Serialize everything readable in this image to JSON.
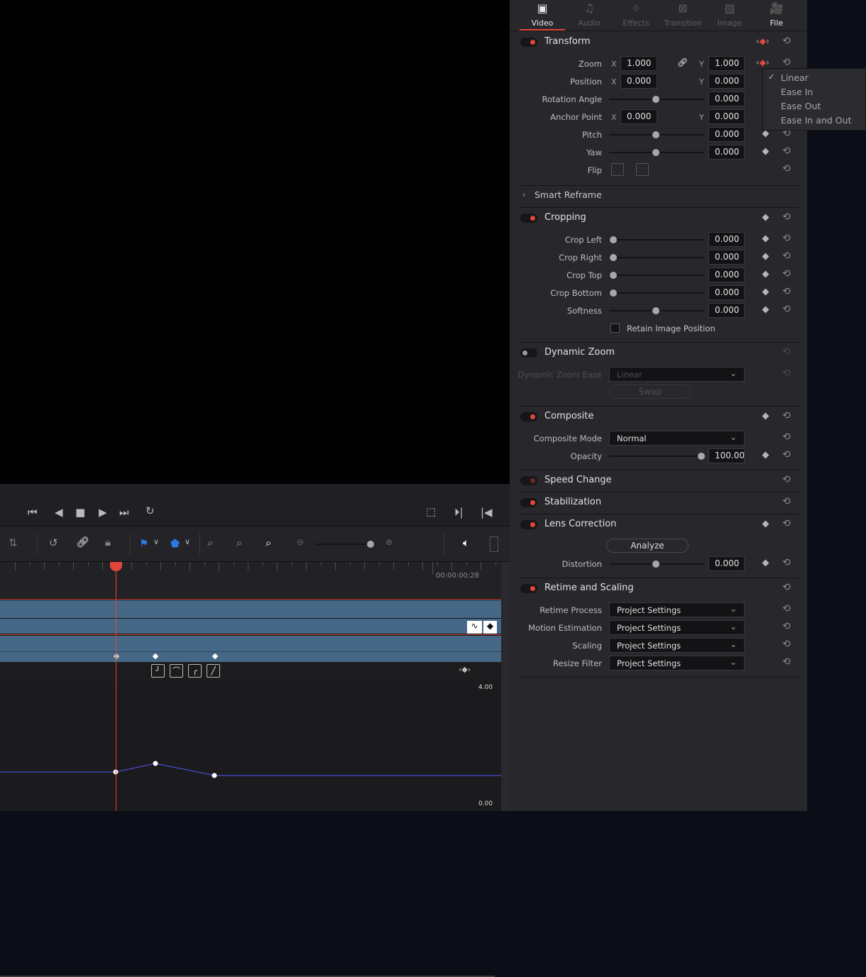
{
  "inspector": {
    "tabs": [
      {
        "label": "Video",
        "icon": "film-icon",
        "glyph": "▣",
        "active": true
      },
      {
        "label": "Audio",
        "icon": "music-note-icon",
        "glyph": "♫"
      },
      {
        "label": "Effects",
        "icon": "magic-wand-icon",
        "glyph": "✧"
      },
      {
        "label": "Transition",
        "icon": "transition-icon",
        "glyph": "⊠"
      },
      {
        "label": "Image",
        "icon": "image-icon",
        "glyph": "▨"
      },
      {
        "label": "File",
        "icon": "file-camera-icon",
        "glyph": "🎥",
        "active_text": true
      }
    ],
    "sections": [
      {
        "name": "transform",
        "title": "Transform",
        "toggle": "on",
        "keyframe": "nav",
        "rows": [
          {
            "label": "Zoom",
            "type": "xy",
            "x": "1.000",
            "y": "1.000",
            "link": true,
            "keyframe": "nav"
          },
          {
            "label": "Position",
            "type": "xy",
            "x": "0.000",
            "y": "0.000"
          },
          {
            "label": "Rotation Angle",
            "type": "slider",
            "value": "0.000",
            "level": 0.5
          },
          {
            "label": "Anchor Point",
            "type": "xy",
            "x": "0.000",
            "y": "0.000"
          },
          {
            "label": "Pitch",
            "type": "slider",
            "value": "0.000",
            "level": 0.5,
            "keyframe": "diamond"
          },
          {
            "label": "Yaw",
            "type": "slider",
            "value": "0.000",
            "level": 0.5,
            "keyframe": "diamond"
          },
          {
            "label": "Flip",
            "type": "flip"
          }
        ]
      },
      {
        "name": "smart-reframe",
        "title": "Smart Reframe",
        "collapsed": true,
        "rows": []
      },
      {
        "name": "cropping",
        "title": "Cropping",
        "toggle": "on",
        "keyframe": "diamond",
        "rows": [
          {
            "label": "Crop Left",
            "type": "slider",
            "value": "0.000",
            "level": 0,
            "keyframe": "diamond"
          },
          {
            "label": "Crop Right",
            "type": "slider",
            "value": "0.000",
            "level": 0,
            "keyframe": "diamond"
          },
          {
            "label": "Crop Top",
            "type": "slider",
            "value": "0.000",
            "level": 0,
            "keyframe": "diamond"
          },
          {
            "label": "Crop Bottom",
            "type": "slider",
            "value": "0.000",
            "level": 0,
            "keyframe": "diamond"
          },
          {
            "label": "Softness",
            "type": "slider",
            "value": "0.000",
            "level": 0.5,
            "keyframe": "diamond"
          },
          {
            "label": "Retain Image Position",
            "type": "checkbox",
            "checked": false
          }
        ]
      },
      {
        "name": "dynamic-zoom",
        "title": "Dynamic Zoom",
        "toggle": "off",
        "rows": [
          {
            "label": "Dynamic Zoom Ease",
            "type": "select",
            "value": "Linear",
            "disabled": true
          },
          {
            "label": "Swap",
            "type": "button",
            "disabled": true
          }
        ]
      },
      {
        "name": "composite",
        "title": "Composite",
        "toggle": "on",
        "keyframe": "diamond",
        "rows": [
          {
            "label": "Composite Mode",
            "type": "select",
            "value": "Normal"
          },
          {
            "label": "Opacity",
            "type": "slider",
            "value": "100.00",
            "level": 1,
            "keyframe": "diamond"
          }
        ]
      },
      {
        "name": "speed-change",
        "title": "Speed Change",
        "toggle": "dim",
        "rows": []
      },
      {
        "name": "stabilization",
        "title": "Stabilization",
        "toggle": "on",
        "rows": []
      },
      {
        "name": "lens-correction",
        "title": "Lens Correction",
        "toggle": "on",
        "keyframe": "diamond",
        "rows": [
          {
            "label": "Analyze",
            "type": "button"
          },
          {
            "label": "Distortion",
            "type": "slider",
            "value": "0.000",
            "level": 0.5,
            "keyframe": "diamond"
          }
        ]
      },
      {
        "name": "retime-and-scaling",
        "title": "Retime and Scaling",
        "toggle": "on",
        "rows": [
          {
            "label": "Retime Process",
            "type": "select",
            "value": "Project Settings"
          },
          {
            "label": "Motion Estimation",
            "type": "select",
            "value": "Project Settings"
          },
          {
            "label": "Scaling",
            "type": "select",
            "value": "Project Settings"
          },
          {
            "label": "Resize Filter",
            "type": "select",
            "value": "Project Settings"
          }
        ]
      }
    ]
  },
  "interpolation_menu": {
    "items": [
      "Linear",
      "Ease In",
      "Ease Out",
      "Ease In and Out"
    ],
    "selected": "Linear"
  },
  "timeline": {
    "timecode": "00:00:00:28",
    "curve_top_label": "4.00",
    "curve_bottom_label": "0.00",
    "playhead_color": "#e0463b",
    "clip_color": "#466887",
    "curve_color": "#4a4ad0"
  },
  "axis_x": "X",
  "axis_y": "Y"
}
